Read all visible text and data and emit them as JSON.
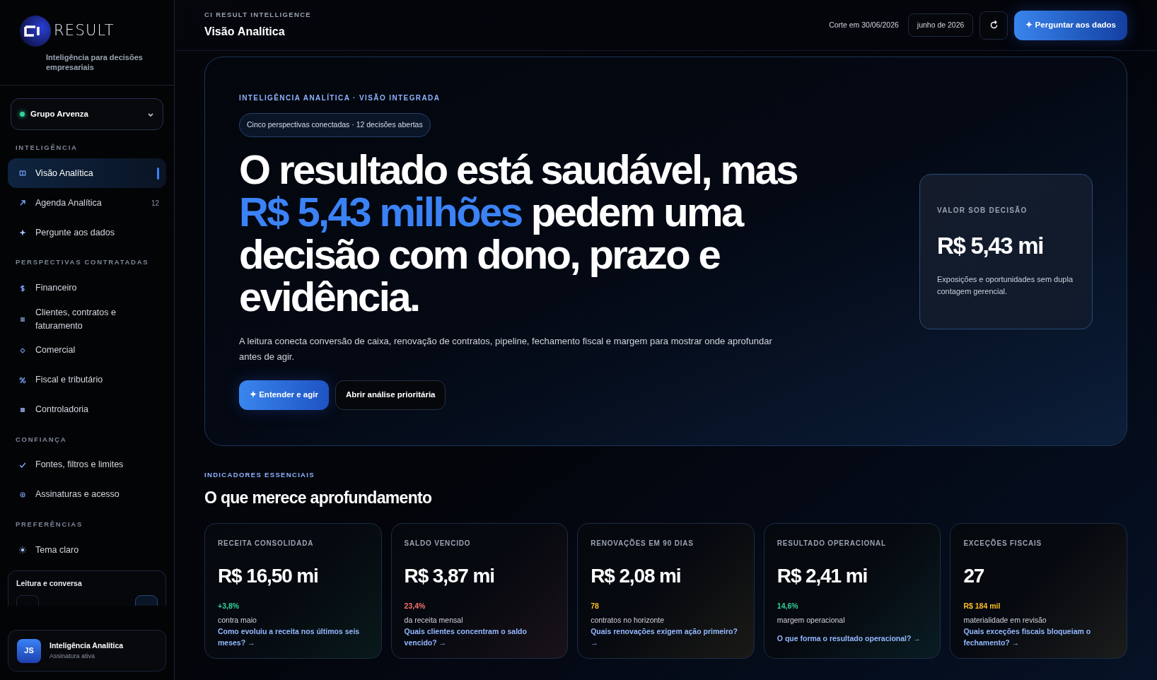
{
  "brand": {
    "name": "RESULT",
    "tagline": "Inteligência para decisões empresariais"
  },
  "company_selector": {
    "label": "Grupo Arvenza",
    "online": true
  },
  "sidebar": [
    {
      "heading": "INTELIGÊNCIA",
      "items": [
        {
          "label": "Visão Analítica",
          "selected": true
        },
        {
          "label": "Agenda Analítica",
          "selected": false,
          "badge": "12"
        },
        {
          "label": "Pergunte aos dados",
          "selected": false
        }
      ]
    },
    {
      "heading": "PERSPECTIVAS CONTRATADAS",
      "items": [
        {
          "label": "Financeiro",
          "selected": false
        },
        {
          "label": "Clientes, contratos e faturamento",
          "selected": false
        },
        {
          "label": "Comercial",
          "selected": false
        },
        {
          "label": "Fiscal e tributário",
          "selected": false
        },
        {
          "label": "Controladoria",
          "selected": false
        }
      ]
    },
    {
      "heading": "CONFIANÇA",
      "items": [
        {
          "label": "Fontes, filtros e limites",
          "selected": false
        },
        {
          "label": "Assinaturas e acesso",
          "selected": false
        }
      ]
    },
    {
      "heading": "PREFERÊNCIAS",
      "items": [
        {
          "label": "Tema claro",
          "selected": false
        }
      ]
    }
  ],
  "reading_panel": {
    "title": "Leitura e conversa"
  },
  "user": {
    "initials": "JS",
    "name": "Inteligência Analítica",
    "status": "Assinatura ativa"
  },
  "header": {
    "eyebrow": "CI RESULT INTELLIGENCE",
    "title": "Visão **Analítica**",
    "cutoff": "Corte em 30/06/2026",
    "period": "junho de 2026",
    "ask_button": "✦ Perguntar aos dados"
  },
  "hero": {
    "eyebrow": "INTELIGÊNCIA ANALÍTICA · VISÃO INTEGRADA",
    "pill": "Cinco perspectivas conectadas · 12 decisões abertas",
    "headline_start": "O resultado está saudável, mas ",
    "headline_highlight": "R$ 5,43 milhões",
    "headline_end": " pedem uma decisão com dono, prazo e evidência.",
    "body": "A leitura conecta conversão de caixa, renovação de contratos, pipeline, fechamento fiscal e margem para mostrar onde aprofundar antes de agir.",
    "primary_button": "✦ Entender e agir",
    "secondary_button": "Abrir análise prioritária",
    "value_card": {
      "label": "VALOR SOB DECISÃO",
      "value": "R$ 5,43 mi",
      "note": "Exposições e oportunidades sem dupla contagem gerencial."
    }
  },
  "indicators": {
    "eyebrow": "INDICADORES ESSENCIAIS",
    "title": "O que merece aprofundamento",
    "cards": [
      {
        "label": "RECEITA CONSOLIDADA",
        "value": "R$ 16,50 mi",
        "delta": "+3,8%",
        "color": "#34d399",
        "caption": "contra maio",
        "link": "Como evoluiu a receita nos últimos seis meses? →"
      },
      {
        "label": "SALDO VENCIDO",
        "value": "R$ 3,87 mi",
        "delta": "23,4%",
        "color": "#f87171",
        "caption": "da receita mensal",
        "link": "Quais clientes concentram o saldo vencido? →"
      },
      {
        "label": "RENOVAÇÕES EM 90 DIAS",
        "value": "R$ 2,08 mi",
        "delta": "78",
        "color": "#fbbf24",
        "caption": "contratos no horizonte",
        "link": "Quais renovações exigem ação primeiro? →"
      },
      {
        "label": "RESULTADO OPERACIONAL",
        "value": "R$ 2,41 mi",
        "delta": "14,6%",
        "color": "#34d399",
        "caption": "margem operacional",
        "link": "O que forma o resultado operacional? →"
      },
      {
        "label": "EXCEÇÕES FISCAIS",
        "value": "27",
        "delta": "R$ 184 mil",
        "color": "#fbbf24",
        "caption": "materialidade em revisão",
        "link": "Quais exceções fiscais bloqueiam o fechamento? →"
      }
    ]
  }
}
